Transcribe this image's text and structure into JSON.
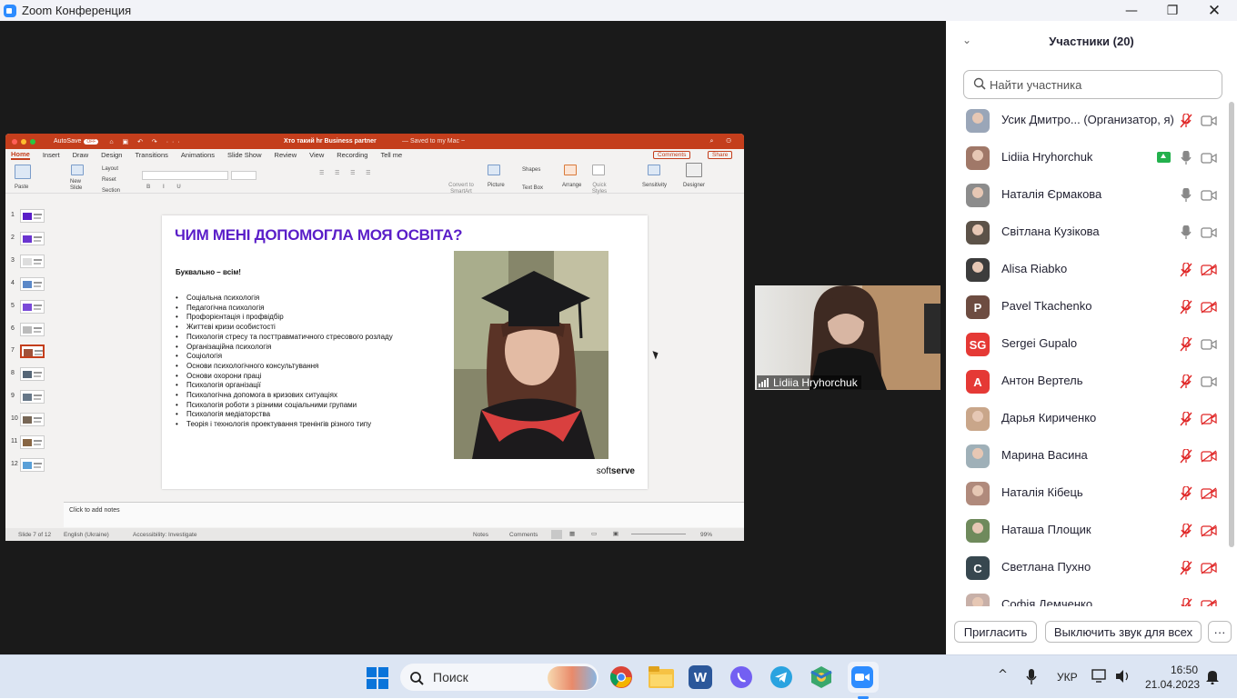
{
  "window": {
    "title": "Zoom Конференция"
  },
  "ppt": {
    "autosave": "AutoSave",
    "autosave_state": "OFF",
    "doc_title": "Хто такий hr Business partner",
    "saved": "— Saved to my Mac ~",
    "tabs": [
      "Home",
      "Insert",
      "Draw",
      "Design",
      "Transitions",
      "Animations",
      "Slide Show",
      "Review",
      "View",
      "Recording",
      "Tell me"
    ],
    "comments": "Comments",
    "share": "Share",
    "ribbon": {
      "paste": "Paste",
      "new_slide": "New Slide",
      "layout": "Layout",
      "reset": "Reset",
      "section": "Section",
      "convert": "Convert to SmartArt",
      "picture": "Picture",
      "shapes": "Shapes",
      "text_box": "Text Box",
      "arrange": "Arrange",
      "quick_styles": "Quick Styles",
      "sensitivity": "Sensitivity",
      "designer": "Designer"
    },
    "thumb_numbers": [
      "1",
      "2",
      "3",
      "4",
      "5",
      "6",
      "7",
      "8",
      "9",
      "10",
      "11",
      "12"
    ],
    "selected_thumb": 7,
    "slide": {
      "heading": "ЧИМ МЕНІ ДОПОМОГЛА МОЯ ОСВІТА?",
      "subheading": "Буквально – всім!",
      "items": [
        "Соціальна психологія",
        "Педагогічна психологія",
        "Профорієнтація і профвідбір",
        "Життєві кризи особистості",
        "Психологія стресу та посттравматичного стресового розладу",
        "Організаційна психологія",
        "Соціологія",
        "Основи психологічного консультування",
        "Основи охорони праці",
        "Психологія організації",
        "Психологічна допомога в кризових ситуаціях",
        "Психологія роботи з різними соціальними групами",
        "Психологія медіаторства",
        "Теорія і технологія проектування тренінгів різного типу"
      ],
      "brand_a": "soft",
      "brand_b": "serve"
    },
    "notes": "Click to add notes",
    "status": {
      "slide": "Slide 7 of 12",
      "lang": "English (Ukraine)",
      "access": "Accessibility: Investigate",
      "notes": "Notes",
      "comments": "Comments",
      "zoom": "99%"
    }
  },
  "video": {
    "name": "Lidiia Hryhorchuk"
  },
  "participants": {
    "title": "Участники (20)",
    "search_placeholder": "Найти участника",
    "list": [
      {
        "name": "Усик Дмитро... (Организатор, я)",
        "initials": "",
        "color": "#9aa6b8",
        "mic": "muted",
        "video": "on"
      },
      {
        "name": "Lidiia Hryhorchuk",
        "initials": "",
        "color": "#a07868",
        "mic": "on",
        "video": "on",
        "sharing": true
      },
      {
        "name": "Наталія Єрмакова",
        "initials": "",
        "color": "#8c8c8c",
        "mic": "on",
        "video": "on"
      },
      {
        "name": "Світлана Кузікова",
        "initials": "",
        "color": "#5c5248",
        "mic": "on",
        "video": "on"
      },
      {
        "name": "Alisa Riabko",
        "initials": "",
        "color": "#3c3c3c",
        "mic": "muted",
        "video": "off"
      },
      {
        "name": "Pavel Tkachenko",
        "initials": "P",
        "color": "#6d4c41",
        "mic": "muted",
        "video": "off"
      },
      {
        "name": "Sergei Gupalo",
        "initials": "SG",
        "color": "#e53935",
        "mic": "muted",
        "video": "on"
      },
      {
        "name": "Антон Вертель",
        "initials": "A",
        "color": "#e53935",
        "mic": "muted",
        "video": "on"
      },
      {
        "name": "Дарья Кириченко",
        "initials": "",
        "color": "#c9a68a",
        "mic": "muted",
        "video": "off"
      },
      {
        "name": "Марина Васина",
        "initials": "",
        "color": "#9fb0b8",
        "mic": "muted",
        "video": "off"
      },
      {
        "name": "Наталія Кібець",
        "initials": "",
        "color": "#b08a7c",
        "mic": "muted",
        "video": "off"
      },
      {
        "name": "Наташа Площик",
        "initials": "",
        "color": "#6f8a5c",
        "mic": "muted",
        "video": "off"
      },
      {
        "name": "Светлана Пухно",
        "initials": "C",
        "color": "#37474f",
        "mic": "muted",
        "video": "off"
      },
      {
        "name": "Софія Демченко",
        "initials": "",
        "color": "#c8b0a8",
        "mic": "muted",
        "video": "off"
      }
    ],
    "invite": "Пригласить",
    "mute_all": "Выключить звук для всех",
    "more": "···"
  },
  "taskbar": {
    "search": "Поиск",
    "lang": "УКР",
    "time": "16:50",
    "date": "21.04.2023"
  },
  "colors": {
    "ppt_accent": "#c43e1c",
    "slide_heading": "#5a1ec8",
    "zoom_blue": "#2d8cff",
    "muted_red": "#e02828"
  }
}
